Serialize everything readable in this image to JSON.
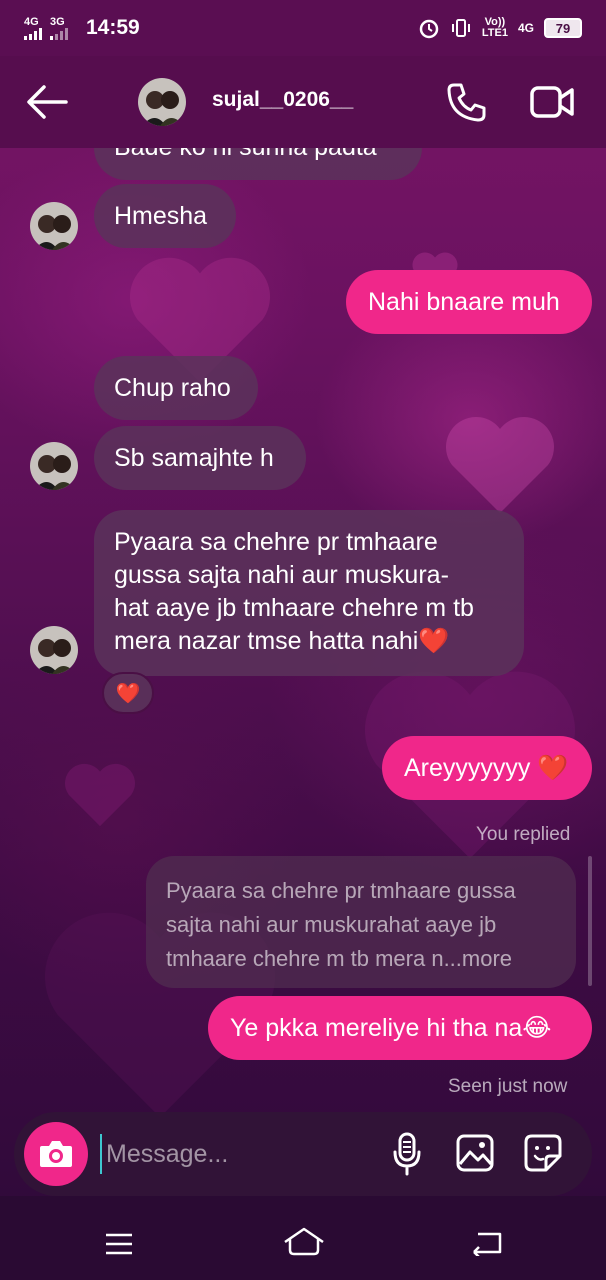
{
  "status_bar": {
    "net1": "4G",
    "net2": "3G",
    "time": "14:59",
    "volte_top": "Vo))",
    "volte_bottom": "LTE1",
    "net3": "4G",
    "battery": "79"
  },
  "header": {
    "username": "sujal__0206__"
  },
  "messages": [
    {
      "id": "m0",
      "direction": "incoming",
      "text": "Bade ko hi sunna padta"
    },
    {
      "id": "m1",
      "direction": "incoming",
      "text": "Hmesha"
    },
    {
      "id": "m2",
      "direction": "outgoing",
      "text": "Nahi bnaare muh"
    },
    {
      "id": "m3",
      "direction": "incoming",
      "text": "Chup raho"
    },
    {
      "id": "m4",
      "direction": "incoming",
      "text": "Sb samajhte h"
    },
    {
      "id": "m5",
      "direction": "incoming",
      "lines": [
        "Pyaara sa chehre pr tmhaare",
        "gussa sajta nahi aur muskura-",
        "hat aaye jb tmhaare chehre m tb",
        "mera nazar tmse hatta nahi❤️"
      ],
      "reaction": "❤️"
    },
    {
      "id": "m6",
      "direction": "outgoing",
      "text": "Areyyyyyyy ❤️"
    },
    {
      "id": "m7",
      "direction": "outgoing",
      "reply_label": "You replied",
      "quote_lines": [
        "Pyaara sa chehre pr tmhaare gussa",
        "sajta nahi aur muskurahat aaye jb",
        "tmhaare chehre m tb mera n...more"
      ],
      "text": "Ye pkka mereliye hi tha na😂"
    }
  ],
  "seen_status": "Seen just now",
  "composer": {
    "placeholder": "Message..."
  },
  "icons": {
    "back": "arrow-left-icon",
    "call": "phone-icon",
    "video": "video-camera-icon",
    "camera": "camera-icon",
    "mic": "microphone-icon",
    "gallery": "image-icon",
    "sticker": "sticker-icon"
  },
  "colors": {
    "accent": "#f0278a",
    "header_bg": "#560d4e",
    "incoming_bubble": "#5a325a",
    "cursor": "#3ec6d0"
  }
}
